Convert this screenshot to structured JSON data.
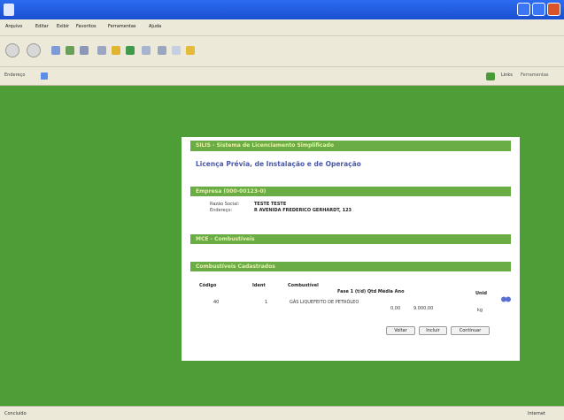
{
  "menu": [
    "Arquivo",
    "Editar",
    "Exibir",
    "Favoritos",
    "Ferramentas",
    "Ajuda"
  ],
  "address": {
    "label": "Endereço",
    "links": "Links",
    "tools": "Ferramentas"
  },
  "page": {
    "system_title": "SILIS - Sistema de Licenciamento Simplificado",
    "subtitle": "Licença Prévia, de Instalação e de Operação",
    "empresa": {
      "title": "Empresa (000-00123-0)",
      "razao_label": "Razão Social:",
      "razao_value": "TESTE TESTE",
      "endereco_label": "Endereço:",
      "endereco_value": "R AVENIDA FREDERICO GERHARDT, 123"
    },
    "mce_title": "MCE - Combustíveis",
    "cadastrados_title": "Combustíveis Cadastrados",
    "table": {
      "headers": {
        "codigo": "Código",
        "ident": "Ident",
        "combustivel": "Combustível",
        "consumo": "Fase 1 (t/d) Qtd Média Ano",
        "unid": "Unid"
      },
      "row": {
        "codigo": "40",
        "ident": "1",
        "combustivel": "GÁS LIQUEFEITO DE PETRÓLEO",
        "v1": "0,00",
        "v2": "9.000,00",
        "unid": "kg"
      }
    },
    "buttons": [
      "Voltar",
      "Incluir",
      "Continuar"
    ]
  },
  "status": {
    "left": "Concluído",
    "right": "Internet"
  }
}
